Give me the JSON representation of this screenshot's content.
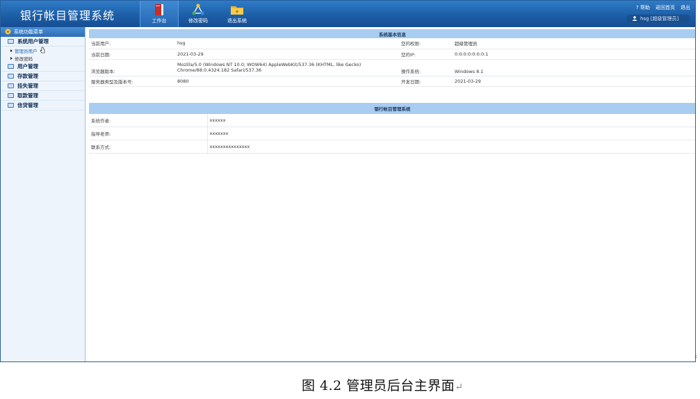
{
  "header": {
    "app_title": "银行帐目管理系统",
    "tools": [
      {
        "label": "工作台",
        "icon": "book-icon"
      },
      {
        "label": "修改密码",
        "icon": "network-icon"
      },
      {
        "label": "退出系统",
        "icon": "folder-icon"
      }
    ],
    "links": {
      "help": "帮助",
      "home": "返回首页",
      "logout": "退出"
    },
    "user": "hsg [超级管理员]"
  },
  "sidebar": {
    "title": "系统功能菜单",
    "menu": [
      {
        "label": "系统用户管理",
        "sub": [
          "管理员用户",
          "修改密码"
        ]
      },
      {
        "label": "用户管理"
      },
      {
        "label": "存款管理"
      },
      {
        "label": "挂失管理"
      },
      {
        "label": "取款管理"
      },
      {
        "label": "信贷管理"
      }
    ]
  },
  "system_info": {
    "title": "系统基本信息",
    "rows": [
      {
        "l1": "当前用户:",
        "v1": "hsg",
        "l2": "您的权限:",
        "v2": "超级管理员"
      },
      {
        "l1": "当前日期:",
        "v1": "2021-03-29",
        "l2": "您的IP:",
        "v2": "0:0:0:0:0:0:0:1"
      },
      {
        "l1": "浏览器版本:",
        "v1": "Mozilla/5.0 (Windows NT 10.0; WOW64) AppleWebKit/537.36 (KHTML, like Gecko) Chrome/88.0.4324.182 Safari/537.36",
        "l2": "操作系统:",
        "v2": "Windows 8.1"
      },
      {
        "l1": "服务器类型及版本号:",
        "v1": "8080",
        "l2": "开发日期:",
        "v2": "2021-03-29"
      }
    ]
  },
  "app_info": {
    "title": "银行帐目管理系统",
    "rows": [
      {
        "label": "系统作者:",
        "value": "xxxxxx"
      },
      {
        "label": "指导老师:",
        "value": "xxxxxxx"
      },
      {
        "label": "联系方式:",
        "value": "xxxxxxxxxxxxxxx"
      }
    ]
  },
  "caption": {
    "text": "图 4.2 管理员后台主界面",
    "mark": "↵"
  },
  "edge_mark": "‹"
}
